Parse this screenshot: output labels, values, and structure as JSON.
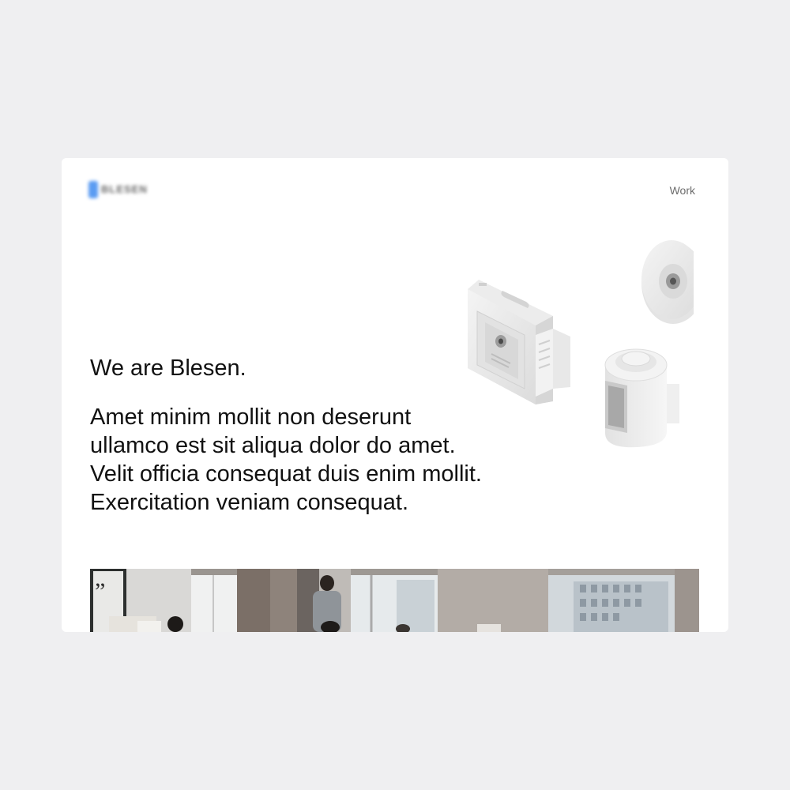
{
  "brand": {
    "logo_text": "BLESEN"
  },
  "nav": {
    "work_label": "Work"
  },
  "hero": {
    "title": "We are Blesen.",
    "body_lines": [
      "Amet minim mollit non deserunt",
      "ullamco est sit aliqua dolor do amet.",
      "Velit officia consequat duis enim mollit.",
      "Exercitation veniam consequat."
    ]
  },
  "photo": {
    "quote_mark": "”"
  },
  "colors": {
    "page_bg": "#efeff1",
    "card_bg": "#ffffff",
    "logo_accent": "#5b9cf2"
  },
  "icons": [
    "smart-camera-device-icon",
    "round-sensor-icon",
    "cylinder-sensor-icon"
  ]
}
